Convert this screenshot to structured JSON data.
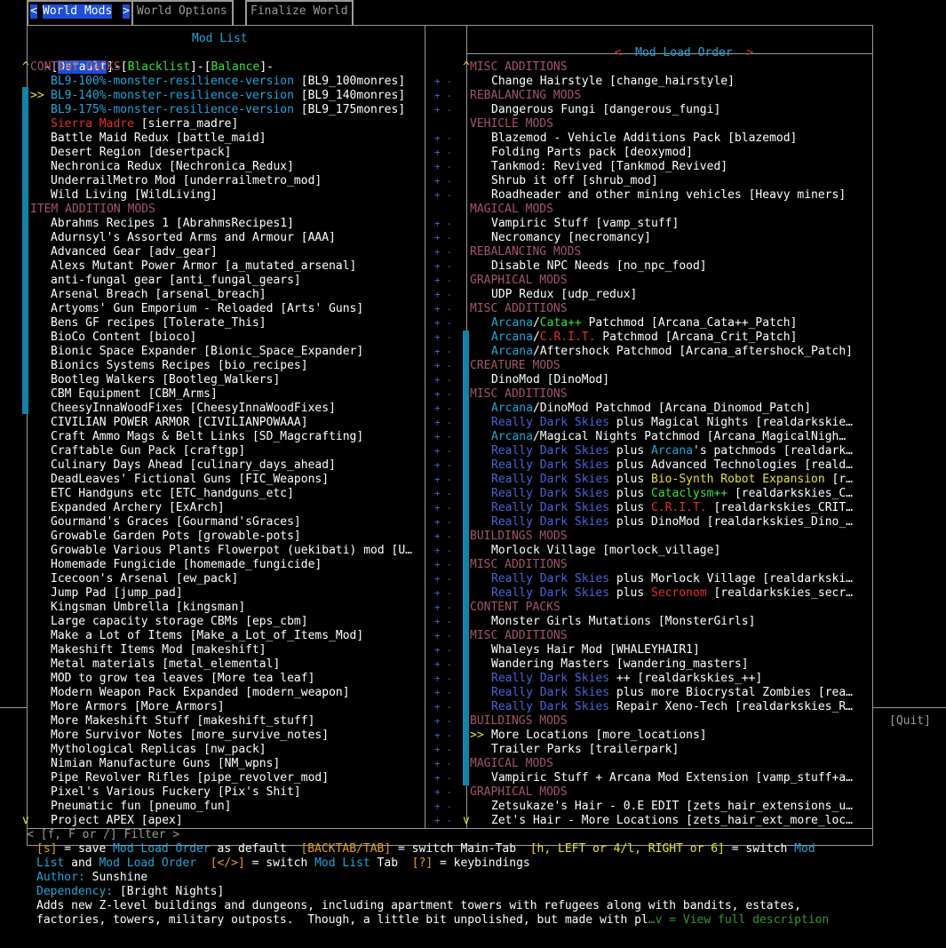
{
  "tabs": {
    "arrow_left": "<",
    "world_mods": "World Mods",
    "arrow_right": ">",
    "world_options": "World Options",
    "finalize": "Finalize World"
  },
  "left_panel": {
    "title": "Mod List",
    "filter_tabs": {
      "sep1": "-[",
      "default": "Default",
      "sep2": "]-[",
      "blacklist": "Blacklist",
      "sep3": "]-[",
      "balance": "Balance",
      "sep4": "]-"
    },
    "scroll_up": "^",
    "scroll_down": "v",
    "cursor": ">>",
    "rows": [
      {
        "type": "header",
        "text": "CONTENT PACKS"
      },
      {
        "segs": [
          {
            "t": "BL9-100%-monster-resilience-version",
            "c": "c-cyan"
          },
          {
            "t": " [BL9_100monres]"
          }
        ],
        "pm": "+ -"
      },
      {
        "segs": [
          {
            "t": "BL9-140%-monster-resilience-version",
            "c": "c-cyan"
          },
          {
            "t": " [BL9_140monres]"
          }
        ],
        "pm": "+ -",
        "cursor": true
      },
      {
        "segs": [
          {
            "t": "BL9-175%-monster-resilience-version",
            "c": "c-cyan"
          },
          {
            "t": " [BL9_175monres]"
          }
        ],
        "pm": "+ -"
      },
      {
        "segs": [
          {
            "t": "Sierra Madre",
            "c": "c-red"
          },
          {
            "t": " [sierra_madre]"
          }
        ],
        "pm": ""
      },
      {
        "segs": [
          {
            "t": "Battle Maid Redux [battle_maid]"
          }
        ],
        "pm": "+ -"
      },
      {
        "segs": [
          {
            "t": "Desert Region [desertpack]"
          }
        ],
        "pm": "+ -"
      },
      {
        "segs": [
          {
            "t": "Nechronica Redux [Nechronica_Redux]"
          }
        ],
        "pm": "+ -"
      },
      {
        "segs": [
          {
            "t": "UnderrailMetro Mod [underrailmetro_mod]"
          }
        ],
        "pm": "+ -"
      },
      {
        "segs": [
          {
            "t": "Wild Living [WildLiving]"
          }
        ],
        "pm": "+ -"
      },
      {
        "type": "header",
        "text": "ITEM ADDITION MODS"
      },
      {
        "segs": [
          {
            "t": "Abrahms Recipes 1 [AbrahmsRecipes1]"
          }
        ],
        "pm": "+ -"
      },
      {
        "segs": [
          {
            "t": "Adurnsyl's Assorted Arms and Armour [AAA]"
          }
        ],
        "pm": "+ -"
      },
      {
        "segs": [
          {
            "t": "Advanced Gear [adv_gear]"
          }
        ],
        "pm": "+ -"
      },
      {
        "segs": [
          {
            "t": "Alexs Mutant Power Armor [a_mutated_arsenal]"
          }
        ],
        "pm": "+ -"
      },
      {
        "segs": [
          {
            "t": "anti-fungal gear [anti_fungal_gears]"
          }
        ],
        "pm": "+ -"
      },
      {
        "segs": [
          {
            "t": "Arsenal Breach [arsenal_breach]"
          }
        ],
        "pm": "+ -"
      },
      {
        "segs": [
          {
            "t": "Artyoms' Gun Emporium - Reloaded [Arts' Guns]"
          }
        ],
        "pm": "+ -"
      },
      {
        "segs": [
          {
            "t": "Bens GF recipes [Tolerate_This]"
          }
        ],
        "pm": "+ -"
      },
      {
        "segs": [
          {
            "t": "BioCo Content [bioco]"
          }
        ],
        "pm": "+ -"
      },
      {
        "segs": [
          {
            "t": "Bionic Space Expander [Bionic_Space_Expander]"
          }
        ],
        "pm": "+ -"
      },
      {
        "segs": [
          {
            "t": "Bionics Systems Recipes [bio_recipes]"
          }
        ],
        "pm": "+ -"
      },
      {
        "segs": [
          {
            "t": "Bootleg Walkers [Bootleg_Walkers]"
          }
        ],
        "pm": "+ -"
      },
      {
        "segs": [
          {
            "t": "CBM Equipment [CBM_Arms]"
          }
        ],
        "pm": "+ -"
      },
      {
        "segs": [
          {
            "t": "CheesyInnaWoodFixes [CheesyInnaWoodFixes]"
          }
        ],
        "pm": "+ -"
      },
      {
        "segs": [
          {
            "t": "CIVILIAN POWER ARMOR [CIVILIANPOWAAA]"
          }
        ],
        "pm": "+ -"
      },
      {
        "segs": [
          {
            "t": "Craft Ammo Mags & Belt Links [SD_Magcrafting]"
          }
        ],
        "pm": "+ -"
      },
      {
        "segs": [
          {
            "t": "Craftable Gun Pack [craftgp]"
          }
        ],
        "pm": "+ -"
      },
      {
        "segs": [
          {
            "t": "Culinary Days Ahead [culinary_days_ahead]"
          }
        ],
        "pm": "+ -"
      },
      {
        "segs": [
          {
            "t": "DeadLeaves' Fictional Guns [FIC_Weapons]"
          }
        ],
        "pm": "+ -"
      },
      {
        "segs": [
          {
            "t": "ETC Handguns etc [ETC_handguns_etc]"
          }
        ],
        "pm": "+ -"
      },
      {
        "segs": [
          {
            "t": "Expanded Archery [ExArch]"
          }
        ],
        "pm": "+ -"
      },
      {
        "segs": [
          {
            "t": "Gourmand's Graces [Gourmand'sGraces]"
          }
        ],
        "pm": "+ -"
      },
      {
        "segs": [
          {
            "t": "Growable Garden Pots [growable-pots]"
          }
        ],
        "pm": "+ -"
      },
      {
        "segs": [
          {
            "t": "Growable Various Plants Flowerpot (uekibati) mod [U…"
          }
        ],
        "pm": "+ -"
      },
      {
        "segs": [
          {
            "t": "Homemade Fungicide [homemade_fungicide]"
          }
        ],
        "pm": "+ -"
      },
      {
        "segs": [
          {
            "t": "Icecoon's Arsenal [ew_pack]"
          }
        ],
        "pm": "+ -"
      },
      {
        "segs": [
          {
            "t": "Jump Pad [jump_pad]"
          }
        ],
        "pm": "+ -"
      },
      {
        "segs": [
          {
            "t": "Kingsman Umbrella [kingsman]"
          }
        ],
        "pm": "+ -"
      },
      {
        "segs": [
          {
            "t": "Large capacity storage CBMs [eps_cbm]"
          }
        ],
        "pm": "+ -"
      },
      {
        "segs": [
          {
            "t": "Make a Lot of Items [Make_a_Lot_of_Items_Mod]"
          }
        ],
        "pm": "+ -"
      },
      {
        "segs": [
          {
            "t": "Makeshift Items Mod [makeshift]"
          }
        ],
        "pm": "+ -"
      },
      {
        "segs": [
          {
            "t": "Metal materials [metal_elemental]"
          }
        ],
        "pm": "+ -"
      },
      {
        "segs": [
          {
            "t": "MOD to grow tea leaves [More tea leaf]"
          }
        ],
        "pm": "+ -"
      },
      {
        "segs": [
          {
            "t": "Modern Weapon Pack Expanded [modern_weapon]"
          }
        ],
        "pm": "+ -"
      },
      {
        "segs": [
          {
            "t": "More Armors [More_Armors]"
          }
        ],
        "pm": "+ -"
      },
      {
        "segs": [
          {
            "t": "More Makeshift Stuff [makeshift_stuff]"
          }
        ],
        "pm": "+ -"
      },
      {
        "segs": [
          {
            "t": "More Survivor Notes [more_survive_notes]"
          }
        ],
        "pm": "+ -"
      },
      {
        "segs": [
          {
            "t": "Mythological Replicas [nw_pack]"
          }
        ],
        "pm": "+ -"
      },
      {
        "segs": [
          {
            "t": "Nimian Manufacture Guns [NM_wpns]"
          }
        ],
        "pm": "+ -"
      },
      {
        "segs": [
          {
            "t": "Pipe Revolver Rifles [pipe_revolver_mod]"
          }
        ],
        "pm": "+ -"
      },
      {
        "segs": [
          {
            "t": "Pixel's Various Fuckery [Pix's Shit]"
          }
        ],
        "pm": "+ -"
      },
      {
        "segs": [
          {
            "t": "Pneumatic fun [pneumo_fun]"
          }
        ],
        "pm": "+ -"
      },
      {
        "segs": [
          {
            "t": "Project APEX [apex]"
          }
        ],
        "pm": "+ -"
      }
    ]
  },
  "right_panel": {
    "title_left_arrow": "<",
    "title": "Mod Load Order",
    "title_right_arrow": ">",
    "scroll_up": "^",
    "scroll_down": "v",
    "cursor": ">>",
    "rows": [
      {
        "type": "header",
        "text": "MISC ADDITIONS"
      },
      {
        "segs": [
          {
            "t": "Change Hairstyle [change_hairstyle]"
          }
        ]
      },
      {
        "type": "header",
        "text": "REBALANCING MODS"
      },
      {
        "segs": [
          {
            "t": "Dangerous Fungi [dangerous_fungi]"
          }
        ]
      },
      {
        "type": "header",
        "text": "VEHICLE MODS"
      },
      {
        "segs": [
          {
            "t": "Blazemod - Vehicle Additions Pack [blazemod]"
          }
        ]
      },
      {
        "segs": [
          {
            "t": "Folding Parts pack [deoxymod]"
          }
        ]
      },
      {
        "segs": [
          {
            "t": "Tankmod: Revived [Tankmod_Revived]"
          }
        ]
      },
      {
        "segs": [
          {
            "t": "Shrub it off [shrub_mod]"
          }
        ]
      },
      {
        "segs": [
          {
            "t": "Roadheader and other mining vehicles [Heavy miners]"
          }
        ]
      },
      {
        "type": "header",
        "text": "MAGICAL MODS"
      },
      {
        "segs": [
          {
            "t": "Vampiric Stuff [vamp_stuff]"
          }
        ]
      },
      {
        "segs": [
          {
            "t": "Necromancy [necromancy]"
          }
        ]
      },
      {
        "type": "header",
        "text": "REBALANCING MODS"
      },
      {
        "segs": [
          {
            "t": "Disable NPC Needs [no_npc_food]"
          }
        ]
      },
      {
        "type": "header",
        "text": "GRAPHICAL MODS"
      },
      {
        "segs": [
          {
            "t": "UDP Redux [udp_redux]"
          }
        ]
      },
      {
        "type": "header",
        "text": "MISC ADDITIONS"
      },
      {
        "segs": [
          {
            "t": "Arcana",
            "c": "c-cyan"
          },
          {
            "t": "/"
          },
          {
            "t": "Cata++",
            "c": "c-green"
          },
          {
            "t": " Patchmod [Arcana_Cata++_Patch]"
          }
        ]
      },
      {
        "segs": [
          {
            "t": "Arcana",
            "c": "c-cyan"
          },
          {
            "t": "/"
          },
          {
            "t": "C.R.I.T.",
            "c": "c-red"
          },
          {
            "t": " Patchmod [Arcana_Crit_Patch]"
          }
        ]
      },
      {
        "segs": [
          {
            "t": "Arcana",
            "c": "c-cyan"
          },
          {
            "t": "/Aftershock Patchmod [Arcana_aftershock_Patch]"
          }
        ]
      },
      {
        "type": "header",
        "text": "CREATURE MODS"
      },
      {
        "segs": [
          {
            "t": "DinoMod [DinoMod]"
          }
        ]
      },
      {
        "type": "header",
        "text": "MISC ADDITIONS"
      },
      {
        "segs": [
          {
            "t": "Arcana",
            "c": "c-cyan"
          },
          {
            "t": "/DinoMod Patchmod [Arcana_Dinomod_Patch]"
          }
        ]
      },
      {
        "segs": [
          {
            "t": "Really Dark Skies",
            "c": "c-blue"
          },
          {
            "t": " plus Magical Nights [realdarkskie…"
          }
        ]
      },
      {
        "segs": [
          {
            "t": "Arcana",
            "c": "c-cyan"
          },
          {
            "t": "/Magical Nights Patchmod [Arcana_MagicalNigh…"
          }
        ]
      },
      {
        "segs": [
          {
            "t": "Really Dark Skies",
            "c": "c-blue"
          },
          {
            "t": " plus "
          },
          {
            "t": "Arcana",
            "c": "c-cyan"
          },
          {
            "t": "'s patchmods [realdark…"
          }
        ]
      },
      {
        "segs": [
          {
            "t": "Really Dark Skies",
            "c": "c-blue"
          },
          {
            "t": " plus Advanced Technologies [reald…"
          }
        ]
      },
      {
        "segs": [
          {
            "t": "Really Dark Skies",
            "c": "c-blue"
          },
          {
            "t": " plus "
          },
          {
            "t": "Bio-Synth Robot Expansion",
            "c": "c-yellow"
          },
          {
            "t": " [r…"
          }
        ]
      },
      {
        "segs": [
          {
            "t": "Really Dark Skies",
            "c": "c-blue"
          },
          {
            "t": " plus "
          },
          {
            "t": "Cataclysm++",
            "c": "c-green"
          },
          {
            "t": " [realdarkskies_C…"
          }
        ]
      },
      {
        "segs": [
          {
            "t": "Really Dark Skies",
            "c": "c-blue"
          },
          {
            "t": " plus "
          },
          {
            "t": "C.R.I.T.",
            "c": "c-red"
          },
          {
            "t": " [realdarkskies_CRIT…"
          }
        ]
      },
      {
        "segs": [
          {
            "t": "Really Dark Skies",
            "c": "c-blue"
          },
          {
            "t": " plus DinoMod [realdarkskies_Dino_…"
          }
        ]
      },
      {
        "type": "header",
        "text": "BUILDINGS MODS"
      },
      {
        "segs": [
          {
            "t": "Morlock Village [morlock_village]"
          }
        ]
      },
      {
        "type": "header",
        "text": "MISC ADDITIONS"
      },
      {
        "segs": [
          {
            "t": "Really Dark Skies",
            "c": "c-blue"
          },
          {
            "t": " plus Morlock Village [realdarkski…"
          }
        ]
      },
      {
        "segs": [
          {
            "t": "Really Dark Skies",
            "c": "c-blue"
          },
          {
            "t": " plus "
          },
          {
            "t": "Secronom",
            "c": "c-red"
          },
          {
            "t": " [realdarkskies_secr…"
          }
        ]
      },
      {
        "type": "header",
        "text": "CONTENT PACKS"
      },
      {
        "segs": [
          {
            "t": "Monster Girls Mutations [MonsterGirls]"
          }
        ]
      },
      {
        "type": "header",
        "text": "MISC ADDITIONS"
      },
      {
        "segs": [
          {
            "t": "Whaleys Hair Mod [WHALEYHAIR1]"
          }
        ]
      },
      {
        "segs": [
          {
            "t": "Wandering Masters [wandering_masters]"
          }
        ]
      },
      {
        "segs": [
          {
            "t": "Really Dark Skies",
            "c": "c-blue"
          },
          {
            "t": " ++ [realdarkskies_++]"
          }
        ]
      },
      {
        "segs": [
          {
            "t": "Really Dark Skies",
            "c": "c-blue"
          },
          {
            "t": " plus more Biocrystal Zombies [rea…"
          }
        ]
      },
      {
        "segs": [
          {
            "t": "Really Dark Skies",
            "c": "c-blue"
          },
          {
            "t": " Repair Xeno-Tech [realdarkskies_R…"
          }
        ]
      },
      {
        "type": "header",
        "text": "BUILDINGS MODS"
      },
      {
        "segs": [
          {
            "t": "More Locations [more_locations]"
          }
        ],
        "cursor": true
      },
      {
        "segs": [
          {
            "t": "Trailer Parks [trailerpark]"
          }
        ]
      },
      {
        "type": "header",
        "text": "MAGICAL MODS"
      },
      {
        "segs": [
          {
            "t": "Vampiric Stuff + Arcana Mod Extension [vamp_stuff+a…"
          }
        ]
      },
      {
        "type": "header",
        "text": "GRAPHICAL MODS"
      },
      {
        "segs": [
          {
            "t": "Zetsukaze's Hair - 0.E EDIT [zets_hair_extensions_u…"
          }
        ]
      },
      {
        "segs": [
          {
            "t": "Zet's Hair - More Locations [zets_hair_ext_more_loc…"
          }
        ]
      }
    ]
  },
  "middle_markers": {
    "rows": [
      "",
      "+ -",
      "+ -",
      "+ -",
      "",
      "+ -",
      "+ -",
      "+ -",
      "+ -",
      "+ -",
      "",
      "+ -",
      "+ -",
      "+ -",
      "+ -",
      "+ -",
      "+ -",
      "+ -",
      "+ -",
      "+ -",
      "+ -",
      "+ -",
      "+ -",
      "+ -",
      "+ -",
      "+ -",
      "+ -",
      "+ -",
      "+ -",
      "+ -",
      "+ -",
      "+ -",
      "+ -",
      "+ -",
      "+ -",
      "+ -",
      "+ -",
      "+ -",
      "+ -",
      "+ -",
      "+ -",
      "+ -",
      "+ -",
      "+ -",
      "+ -",
      "+ -",
      "+ -",
      "+ -",
      "+ -",
      "+ -",
      "+ -",
      "+ -",
      "+ -",
      "+ -"
    ]
  },
  "filter": {
    "text": "< [f, F or /] Filter >"
  },
  "help": {
    "line1": [
      {
        "t": "[s]",
        "c": "c-orange"
      },
      {
        "t": " = save "
      },
      {
        "t": "Mod Load Order",
        "c": "c-cyan"
      },
      {
        "t": " as default  "
      },
      {
        "t": "[BACKTAB/TAB]",
        "c": "c-orange"
      },
      {
        "t": " = switch Main-Tab  "
      },
      {
        "t": "[h, LEFT or 4/l, RIGHT or 6]",
        "c": "c-yellow"
      },
      {
        "t": " = switch "
      },
      {
        "t": "Mod",
        "c": "c-cyan"
      }
    ],
    "line2": [
      {
        "t": "List",
        "c": "c-cyan"
      },
      {
        "t": " and "
      },
      {
        "t": "Mod Load Order",
        "c": "c-cyan"
      },
      {
        "t": "  "
      },
      {
        "t": "[<",
        "c": "c-orange"
      },
      {
        "t": "/",
        "c": "c-orange"
      },
      {
        "t": ">]",
        "c": "c-orange"
      },
      {
        "t": " = switch "
      },
      {
        "t": "Mod List",
        "c": "c-cyan"
      },
      {
        "t": " Tab  "
      },
      {
        "t": "[?]",
        "c": "c-orange"
      },
      {
        "t": " = keybindings"
      }
    ]
  },
  "info": {
    "author_label": "Author:",
    "author_value": " Sunshine",
    "dependency_label": "Dependency:",
    "dependency_value": " [Bright Nights]",
    "description_line1": "Adds new Z-level buildings and dungeons, including apartment towers with refugees along with bandits, estates,",
    "description_line2": "factories, towers, military outposts.  Though, a little bit unpolished, but made with pl",
    "view_full": "…v = View full description"
  },
  "quit": "[Quit]"
}
